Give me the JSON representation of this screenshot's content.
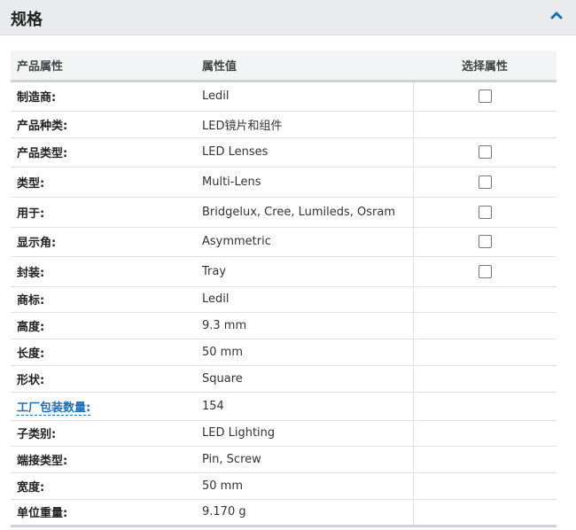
{
  "header": {
    "title": "规格"
  },
  "table": {
    "columns": [
      "产品属性",
      "属性值",
      "选择属性"
    ],
    "rows": [
      {
        "label": "制造商:",
        "value": "Ledil",
        "checkbox": true,
        "link": false
      },
      {
        "label": "产品种类:",
        "value": "LED镜片和组件",
        "checkbox": false,
        "link": false
      },
      {
        "label": "产品类型:",
        "value": "LED Lenses",
        "checkbox": true,
        "link": false
      },
      {
        "label": "类型:",
        "value": "Multi-Lens",
        "checkbox": true,
        "link": false
      },
      {
        "label": "用于:",
        "value": "Bridgelux, Cree, Lumileds, Osram",
        "checkbox": true,
        "link": false
      },
      {
        "label": "显示角:",
        "value": "Asymmetric",
        "checkbox": true,
        "link": false
      },
      {
        "label": "封装:",
        "value": "Tray",
        "checkbox": true,
        "link": false
      },
      {
        "label": "商标:",
        "value": "Ledil",
        "checkbox": false,
        "link": false
      },
      {
        "label": "高度:",
        "value": "9.3 mm",
        "checkbox": false,
        "link": false
      },
      {
        "label": "长度:",
        "value": "50 mm",
        "checkbox": false,
        "link": false
      },
      {
        "label": "形状:",
        "value": "Square",
        "checkbox": false,
        "link": false
      },
      {
        "label": "工厂包装数量:",
        "value": "154",
        "checkbox": false,
        "link": true
      },
      {
        "label": "子类别:",
        "value": "LED Lighting",
        "checkbox": false,
        "link": false
      },
      {
        "label": "端接类型:",
        "value": "Pin, Screw",
        "checkbox": false,
        "link": false
      },
      {
        "label": "宽度:",
        "value": "50 mm",
        "checkbox": false,
        "link": false
      },
      {
        "label": "单位重量:",
        "value": "9.170 g",
        "checkbox": false,
        "link": false
      }
    ]
  },
  "colors": {
    "accent": "#1a6fb5",
    "header_bg": "#e9ebee"
  },
  "icons": {
    "collapse": "chevron-up-icon"
  }
}
